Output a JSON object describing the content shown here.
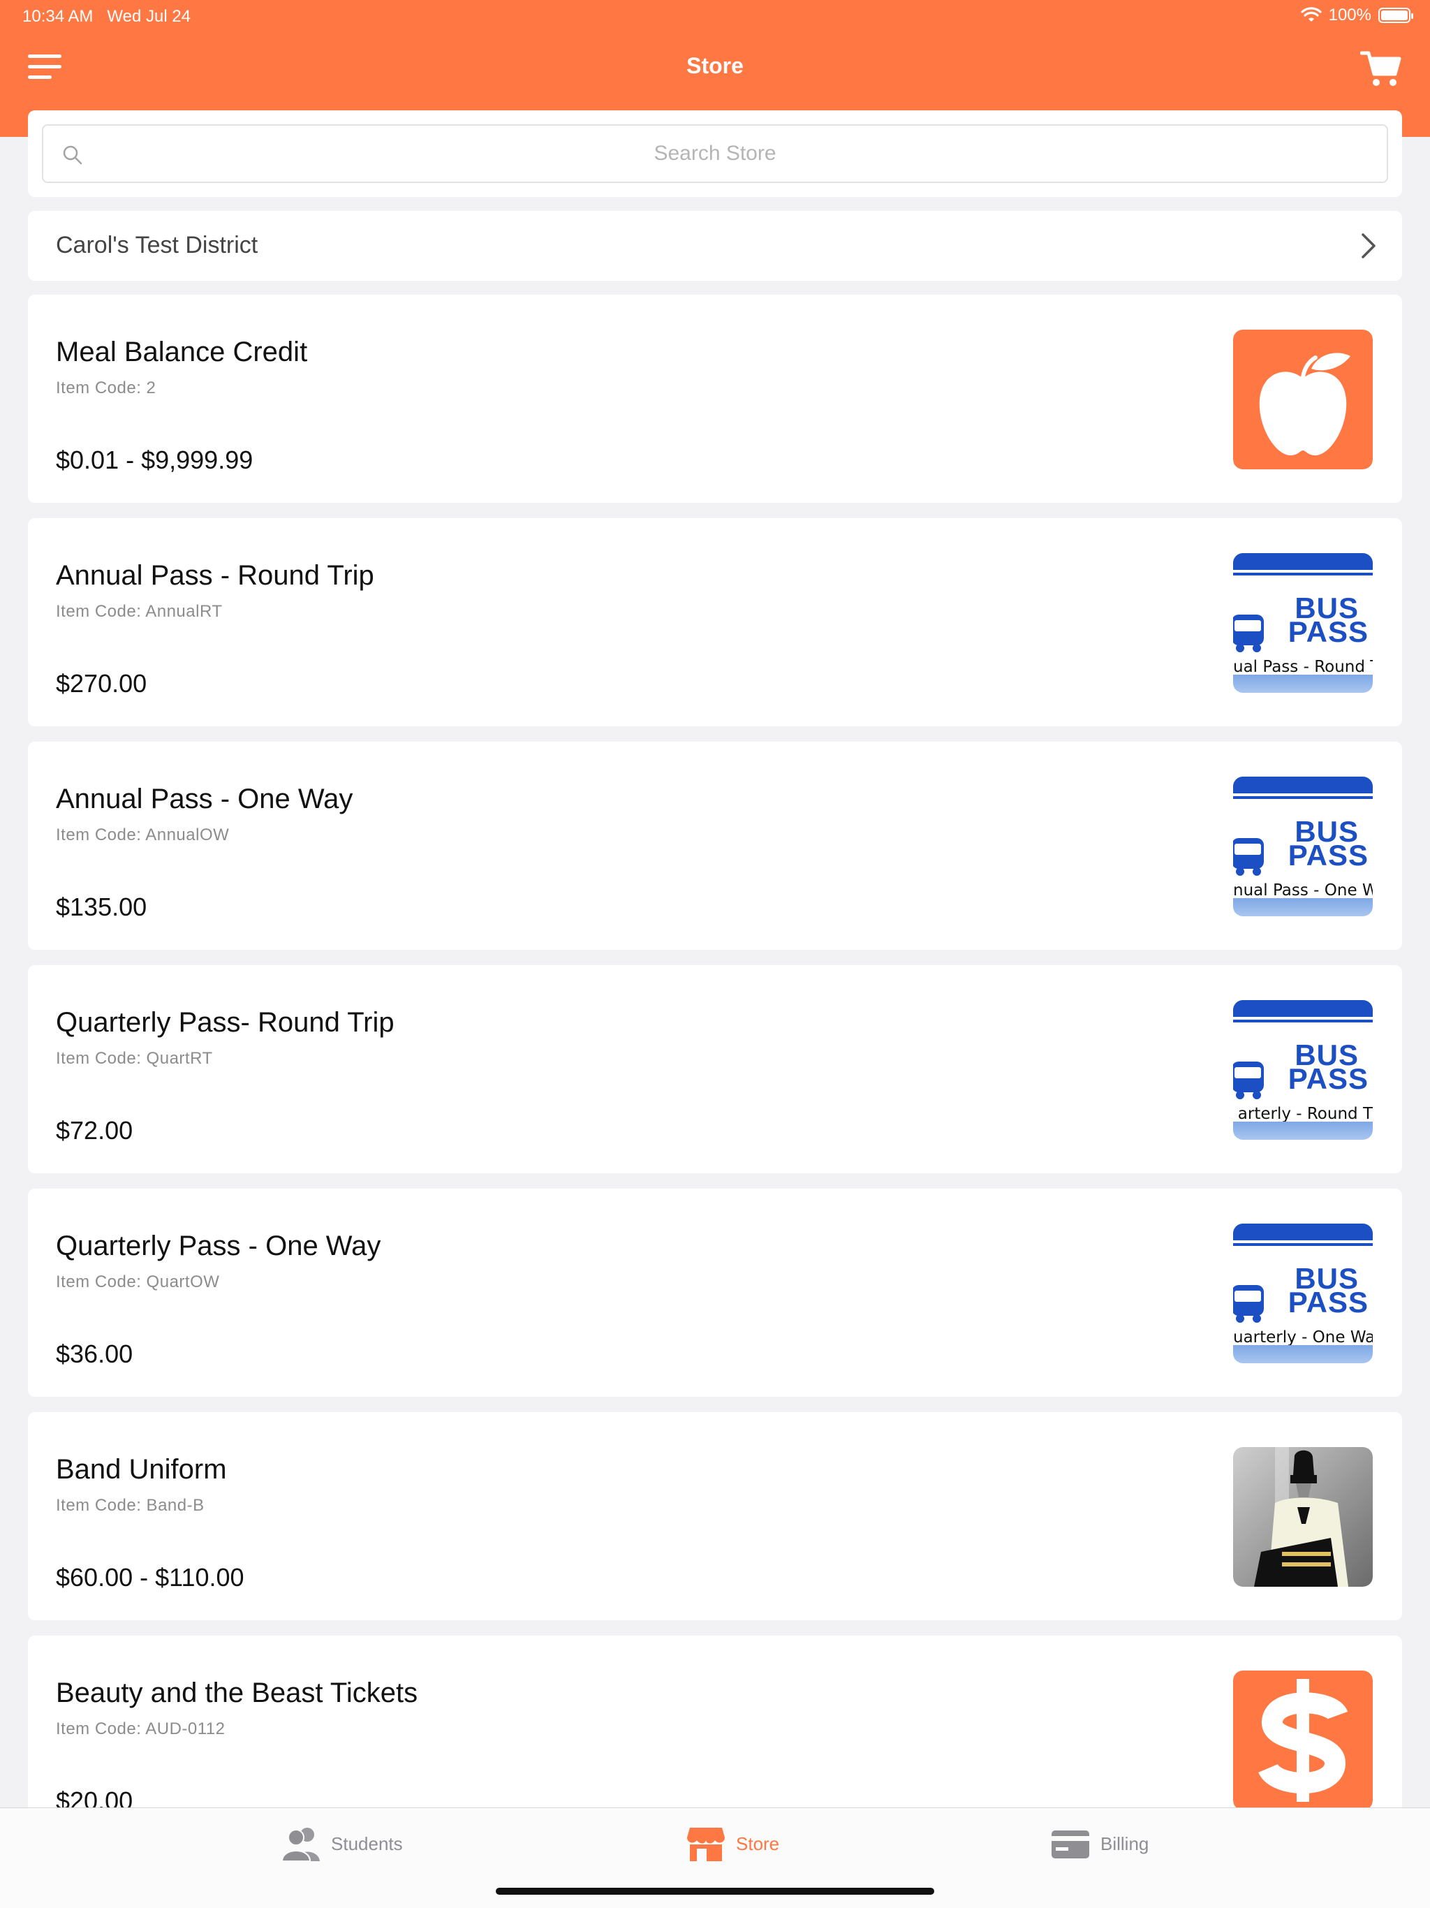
{
  "status_bar": {
    "time": "10:34 AM",
    "date": "Wed Jul 24",
    "battery": "100%"
  },
  "nav": {
    "title": "Store"
  },
  "search": {
    "placeholder": "Search Store"
  },
  "district": {
    "label": "Carol's Test District"
  },
  "products": [
    {
      "name": "Meal Balance Credit",
      "code": "Item Code: 2",
      "price": "$0.01 - $9,999.99",
      "icon": "apple-icon"
    },
    {
      "name": "Annual Pass - Round Trip",
      "code": "Item Code: AnnualRT",
      "price": "$270.00",
      "icon": "bus-pass-image",
      "thumb_text": "ual Pass - Round T"
    },
    {
      "name": "Annual Pass - One Way",
      "code": "Item Code: AnnualOW",
      "price": "$135.00",
      "icon": "bus-pass-image",
      "thumb_text": "nual Pass - One W"
    },
    {
      "name": "Quarterly Pass- Round Trip",
      "code": "Item Code: QuartRT",
      "price": "$72.00",
      "icon": "bus-pass-image",
      "thumb_text": "arterly - Round T"
    },
    {
      "name": "Quarterly Pass - One Way",
      "code": "Item Code: QuartOW",
      "price": "$36.00",
      "icon": "bus-pass-image",
      "thumb_text": "uarterly - One Wa"
    },
    {
      "name": "Band Uniform",
      "code": "Item Code: Band-B",
      "price": "$60.00 - $110.00",
      "icon": "band-uniform-photo"
    },
    {
      "name": "Beauty and the Beast Tickets",
      "code": "Item Code: AUD-0112",
      "price": "$20.00",
      "icon": "dollar-icon"
    }
  ],
  "bus_pass": {
    "line1": "BUS",
    "line2": "PASS"
  },
  "tabs": [
    {
      "label": "Students",
      "icon": "students-icon"
    },
    {
      "label": "Store",
      "icon": "store-icon",
      "active": true
    },
    {
      "label": "Billing",
      "icon": "billing-icon"
    }
  ],
  "colors": {
    "accent": "#ff7843",
    "bus_blue": "#1d4fc4",
    "inactive": "#8e8e93"
  }
}
